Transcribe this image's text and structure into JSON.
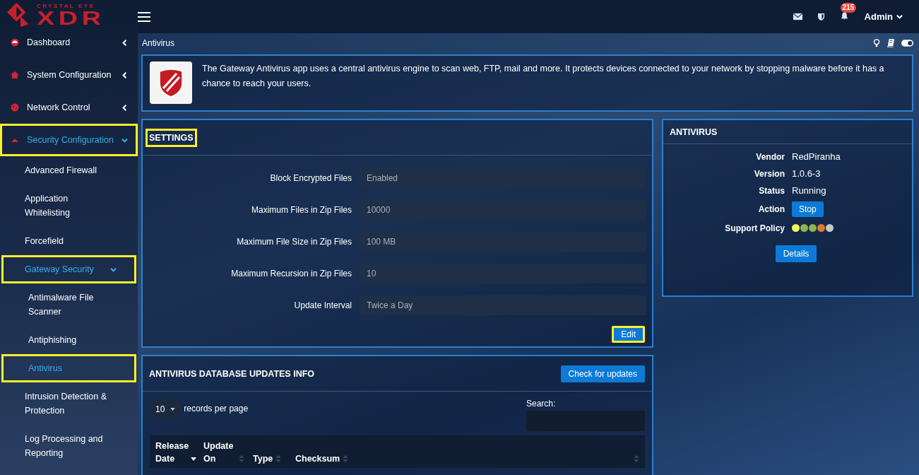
{
  "logo": {
    "tagline": "CRYSTAL EYE",
    "wordmark": "XDR"
  },
  "topbar": {
    "notifications": "215",
    "user": "Admin"
  },
  "sidebar": {
    "items": [
      {
        "label": "Dashboard",
        "selected": false,
        "expanded": false,
        "highlighted": false
      },
      {
        "label": "System Configuration",
        "selected": false,
        "expanded": false,
        "highlighted": false
      },
      {
        "label": "Network Control",
        "selected": false,
        "expanded": false,
        "highlighted": false
      },
      {
        "label": "Security Configuration",
        "selected": true,
        "expanded": true,
        "highlighted": true,
        "children": [
          {
            "label": "Advanced Firewall",
            "selected": false,
            "highlighted": false
          },
          {
            "label": "Application Whitelisting",
            "selected": false,
            "highlighted": false
          },
          {
            "label": "Forcefield",
            "selected": false,
            "highlighted": false
          },
          {
            "label": "Gateway Security",
            "selected": true,
            "expanded": true,
            "highlighted": true,
            "children": [
              {
                "label": "Antimalware File Scanner",
                "selected": false,
                "highlighted": false
              },
              {
                "label": "Antiphishing",
                "selected": false,
                "highlighted": false
              },
              {
                "label": "Antivirus",
                "selected": true,
                "highlighted": true
              }
            ]
          },
          {
            "label": "Intrusion Detection & Protection",
            "selected": false,
            "highlighted": false
          },
          {
            "label": "Log Processing and Reporting",
            "selected": false,
            "highlighted": false
          }
        ]
      }
    ]
  },
  "page": {
    "title": "Antivirus",
    "toggle_on": true
  },
  "info": {
    "text": "The Gateway Antivirus app uses a central antivirus engine to scan web, FTP, mail and more. It protects devices connected to your network by stopping malware before it has a chance to reach your users."
  },
  "settings": {
    "title": "SETTINGS",
    "title_highlighted": true,
    "fields": [
      {
        "label": "Block Encrypted Files",
        "value": "Enabled"
      },
      {
        "label": "Maximum Files in Zip Files",
        "value": "10000"
      },
      {
        "label": "Maximum File Size in Zip Files",
        "value": "100 MB"
      },
      {
        "label": "Maximum Recursion in Zip Files",
        "value": "10"
      },
      {
        "label": "Update Interval",
        "value": "Twice a Day"
      }
    ],
    "edit_button": {
      "label": "Edit",
      "highlighted": true
    }
  },
  "antivirus": {
    "title": "ANTIVIRUS",
    "rows": [
      {
        "kind": "text",
        "label": "Vendor",
        "value": "RedPiranha"
      },
      {
        "kind": "text",
        "label": "Version",
        "value": "1.0.6-3"
      },
      {
        "kind": "text",
        "label": "Status",
        "value": "Running"
      },
      {
        "kind": "button",
        "label": "Action",
        "value": "Stop"
      },
      {
        "kind": "dots",
        "label": "Support Policy",
        "dots": [
          {
            "color": "#f2f25c"
          },
          {
            "color": "#8fb452"
          },
          {
            "color": "#8fb452"
          },
          {
            "color": "#e07b32"
          },
          {
            "color": "#c9c9c9"
          }
        ]
      }
    ],
    "details_button": "Details"
  },
  "updates": {
    "title": "ANTIVIRUS DATABASE UPDATES INFO",
    "check_button": "Check for updates",
    "page_size": "10",
    "page_size_label": "records per page",
    "search_label": "Search:",
    "columns": [
      {
        "label": "Release Date",
        "sorted": true
      },
      {
        "label": "Update On",
        "sorted": false
      },
      {
        "label": "Type",
        "sorted": false
      },
      {
        "label": "Checksum",
        "sorted": false
      }
    ]
  }
}
